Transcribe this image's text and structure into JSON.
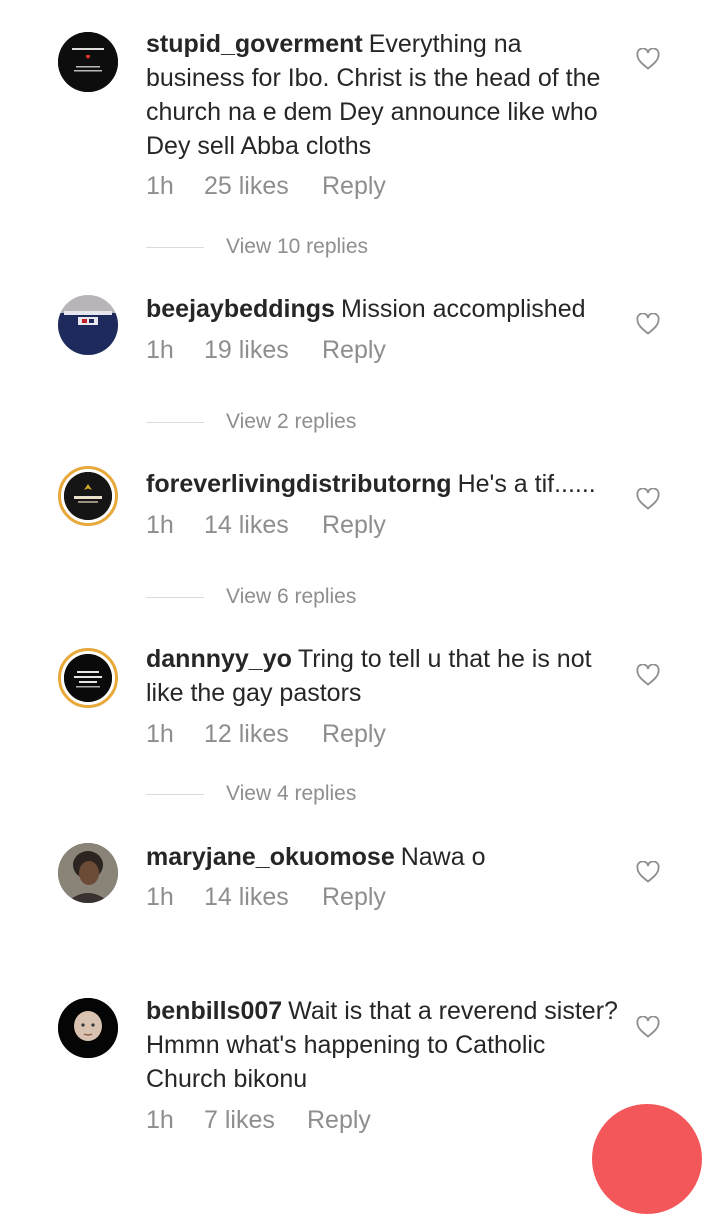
{
  "comments": [
    {
      "username": "stupid_goverment",
      "text": "Everything na business for Ibo. Christ is the head of the church na e dem Dey announce like who Dey sell Abba cloths",
      "time": "1h",
      "likes": "25 likes",
      "reply": "Reply",
      "view_replies": "View 10 replies",
      "avatar_icon": "black-square-text-avatar"
    },
    {
      "username": "beejaybeddings",
      "text": "Mission accomplished",
      "time": "1h",
      "likes": "19 likes",
      "reply": "Reply",
      "view_replies": "View 2 replies",
      "avatar_icon": "bedding-avatar"
    },
    {
      "username": "foreverlivingdistributorng",
      "text": "He's a tif......",
      "time": "1h",
      "likes": "14 likes",
      "reply": "Reply",
      "view_replies": "View 6 replies",
      "avatar_icon": "forever-logo-avatar"
    },
    {
      "username": "dannnyy_yo",
      "text": "Tring to tell u that he is not like the gay pastors",
      "time": "1h",
      "likes": "12 likes",
      "reply": "Reply",
      "view_replies": "View 4 replies",
      "avatar_icon": "black-text-avatar"
    },
    {
      "username": "maryjane_okuomose",
      "text": "Nawa o",
      "time": "1h",
      "likes": "14 likes",
      "reply": "Reply",
      "avatar_icon": "woman-photo-avatar"
    },
    {
      "username": "benbills007",
      "text": "Wait is that a reverend sister?Hmmn what's happening to Catholic Church bikonu",
      "time": "1h",
      "likes": "7 likes",
      "reply": "Reply",
      "avatar_icon": "baby-photo-avatar"
    }
  ],
  "colors": {
    "text": "#262626",
    "muted": "#8e8e8e",
    "divider": "#dbdbdb",
    "story_ring": "#e8a93a",
    "fab": "#f4575a"
  }
}
